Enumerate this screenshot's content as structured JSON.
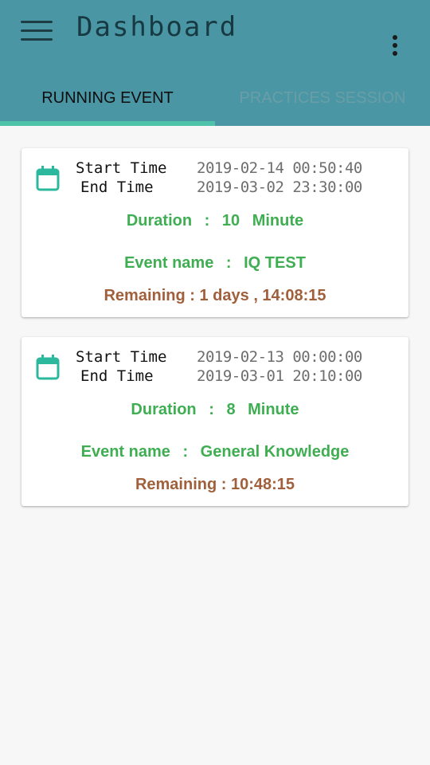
{
  "app_bar": {
    "title": "Dashboard",
    "menu_icon": "hamburger-menu-icon",
    "overflow_icon": "more-vertical-icon"
  },
  "tabs": [
    {
      "label": "RUNNING EVENT",
      "active": true
    },
    {
      "label": "PRACTICES SESSION",
      "active": false
    }
  ],
  "colors": {
    "app_bar": "#4a96a4",
    "tab_indicator": "#4fc3a9",
    "green_text": "#3fae52",
    "remaining_text": "#a0603c",
    "calendar_icon": "#2bb89c"
  },
  "events": [
    {
      "start_label": "Start Time",
      "end_label": "End Time",
      "start_time": "2019-02-14  00:50:40",
      "end_time": "2019-03-02  23:30:00",
      "duration_label": "Duration",
      "duration_sep": ":",
      "duration_value": "10",
      "duration_unit": "Minute",
      "event_name_label": "Event name",
      "event_name_sep": ":",
      "event_name": "IQ TEST",
      "remaining": "Remaining : 1 days , 14:08:15",
      "icon": "calendar-icon"
    },
    {
      "start_label": "Start Time",
      "end_label": "End Time",
      "start_time": "2019-02-13  00:00:00",
      "end_time": "2019-03-01  20:10:00",
      "duration_label": "Duration",
      "duration_sep": ":",
      "duration_value": "8",
      "duration_unit": "Minute",
      "event_name_label": "Event name",
      "event_name_sep": ":",
      "event_name": "General Knowledge",
      "remaining": "Remaining : 10:48:15",
      "icon": "calendar-icon"
    }
  ]
}
